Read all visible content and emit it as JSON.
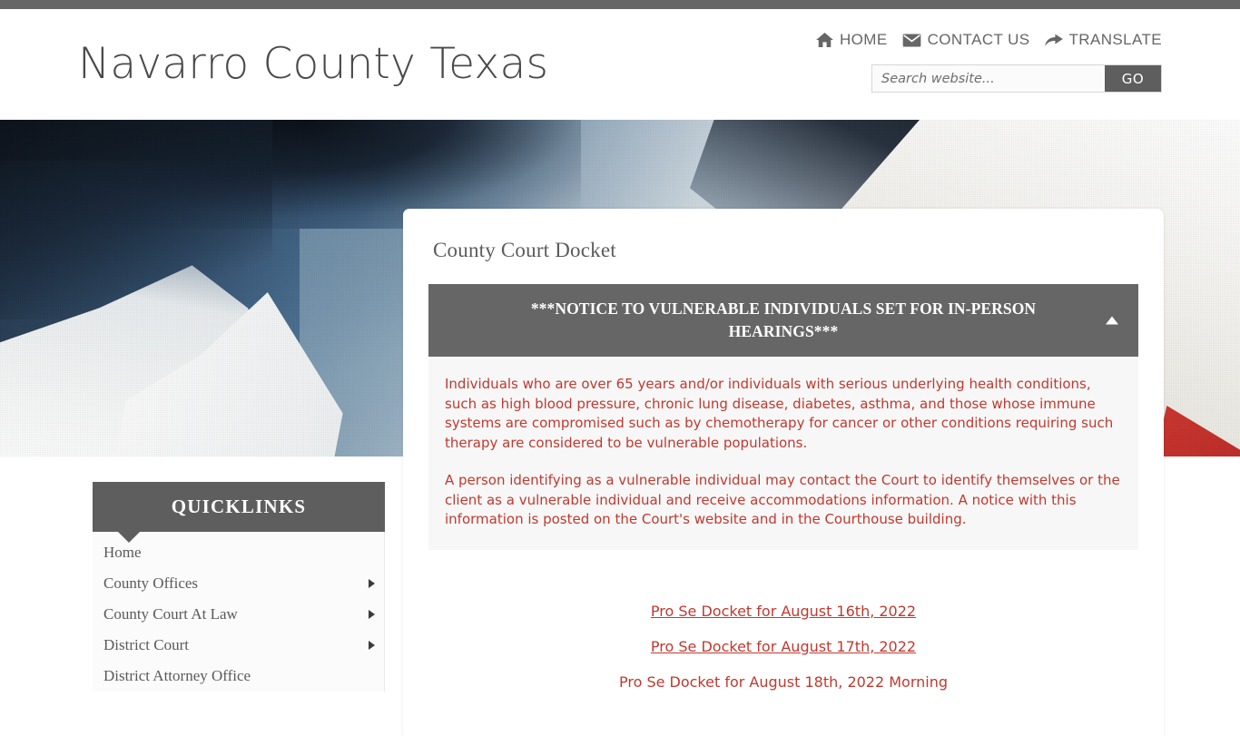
{
  "header": {
    "site_title": "Navarro County Texas",
    "nav": [
      {
        "label": "HOME",
        "icon": "home-icon"
      },
      {
        "label": "CONTACT US",
        "icon": "envelope-icon"
      },
      {
        "label": "TRANSLATE",
        "icon": "arrow-share-icon"
      }
    ],
    "search": {
      "placeholder": "Search website...",
      "value": "",
      "button_label": "GO"
    }
  },
  "main": {
    "page_title": "County Court Docket",
    "notice": {
      "heading": "***NOTICE TO VULNERABLE INDIVIDUALS SET FOR IN-PERSON HEARINGS***",
      "toggle_state": "expanded",
      "paragraphs": [
        "Individuals who are over 65 years and/or individuals with serious underlying health conditions, such as high blood pressure, chronic lung disease, diabetes, asthma, and those whose immune systems are compromised such as by chemotherapy for cancer or other conditions requiring such therapy are considered to be vulnerable populations.",
        "A person identifying as a vulnerable individual may contact the Court to identify themselves or the client as a vulnerable individual and receive accommodations information. A notice with this information is posted on the Court's website and in the Courthouse building."
      ]
    },
    "docket_links": [
      "Pro Se Docket for August 16th, 2022",
      "Pro Se Docket for August 17th, 2022",
      "Pro Se Docket for August 18th, 2022 Morning"
    ]
  },
  "sidebar": {
    "title": "QUICKLINKS",
    "items": [
      {
        "label": "Home",
        "has_submenu": false
      },
      {
        "label": "County Offices",
        "has_submenu": true
      },
      {
        "label": "County Court At Law",
        "has_submenu": true
      },
      {
        "label": "District Court",
        "has_submenu": true
      },
      {
        "label": "District Attorney Office",
        "has_submenu": false
      }
    ]
  },
  "colors": {
    "accent_gray": "#666666",
    "header_gray": "#5e5e5e",
    "link_red": "#c0392f",
    "title_gray": "#4a4a4a",
    "notice_bg": "#f7f7f7"
  }
}
